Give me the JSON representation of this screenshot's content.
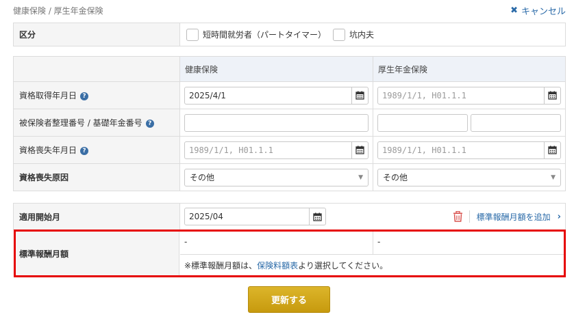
{
  "breadcrumb": "健康保険 / 厚生年金保険",
  "cancel_label": "キャンセル",
  "kubun": {
    "label": "区分",
    "options": [
      {
        "label": "短時間就労者（パートタイマー）",
        "checked": false
      },
      {
        "label": "坑内夫",
        "checked": false
      }
    ]
  },
  "columns": {
    "kenpo": "健康保険",
    "kosei": "厚生年金保険"
  },
  "rows": {
    "shutoku": {
      "label": "資格取得年月日",
      "kenpo_value": "2025/4/1",
      "kosei_placeholder": "1989/1/1, H01.1.1"
    },
    "seiri": {
      "label": "被保険者整理番号 / 基礎年金番号",
      "kenpo_value": "",
      "kosei_value_1": "",
      "kosei_value_2": ""
    },
    "soshitsu": {
      "label": "資格喪失年月日",
      "kenpo_placeholder": "1989/1/1, H01.1.1",
      "kosei_placeholder": "1989/1/1, H01.1.1"
    },
    "genin": {
      "label": "資格喪失原因",
      "kenpo_selected": "その他",
      "kosei_selected": "その他"
    }
  },
  "hyojun": {
    "apply_label": "適用開始月",
    "apply_value": "2025/04",
    "add_link": "標準報酬月額を追加",
    "label": "標準報酬月額",
    "kenpo_value": "-",
    "kosei_value": "-",
    "note_prefix": "※標準報酬月額は、",
    "note_link": "保険料額表",
    "note_suffix": "より選択してください。"
  },
  "submit_label": "更新する",
  "icons": {
    "help": "?",
    "cancel": "✖",
    "chevron": "›"
  },
  "colors": {
    "link": "#2a6aa8",
    "highlight": "#e60000",
    "submit": "#d4a61b",
    "trash": "#d9534f"
  }
}
